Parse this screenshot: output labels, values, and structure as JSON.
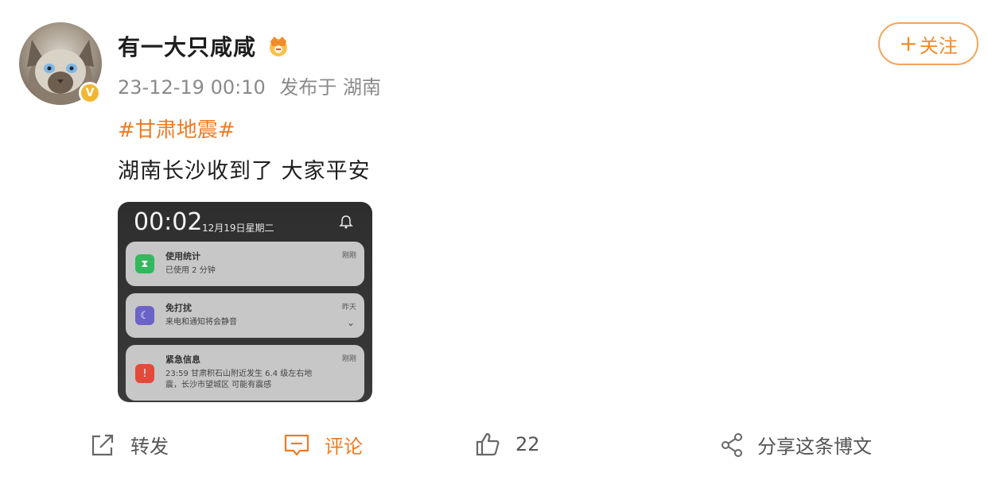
{
  "user": {
    "name": "有一大只咸咸",
    "timestamp": "23-12-19 00:10",
    "source": "发布于 湖南",
    "verify_badge": "V"
  },
  "follow_button": {
    "plus": "+",
    "label": "关注"
  },
  "post": {
    "hashtag": "#甘肃地震#",
    "text": "湖南长沙收到了 大家平安"
  },
  "image": {
    "time": "00:02",
    "date": "12月19日星期二",
    "notifications": [
      {
        "title": "使用统计",
        "body": "已使用 2 分钟",
        "time": "刚刚"
      },
      {
        "title": "免打扰",
        "body": "来电和通知将会静音",
        "time": "昨天"
      },
      {
        "title": "紧急信息",
        "body": "23:59 甘肃积石山附近发生 6.4 级左右地震，长沙市望城区 可能有震感",
        "time": "刚刚"
      }
    ]
  },
  "actions": {
    "repost": "转发",
    "comment": "评论",
    "like_count": "22",
    "share": "分享这条博文"
  },
  "colors": {
    "accent": "#f07a21",
    "follow_border": "#f3a55b",
    "verify": "#f2b632"
  }
}
